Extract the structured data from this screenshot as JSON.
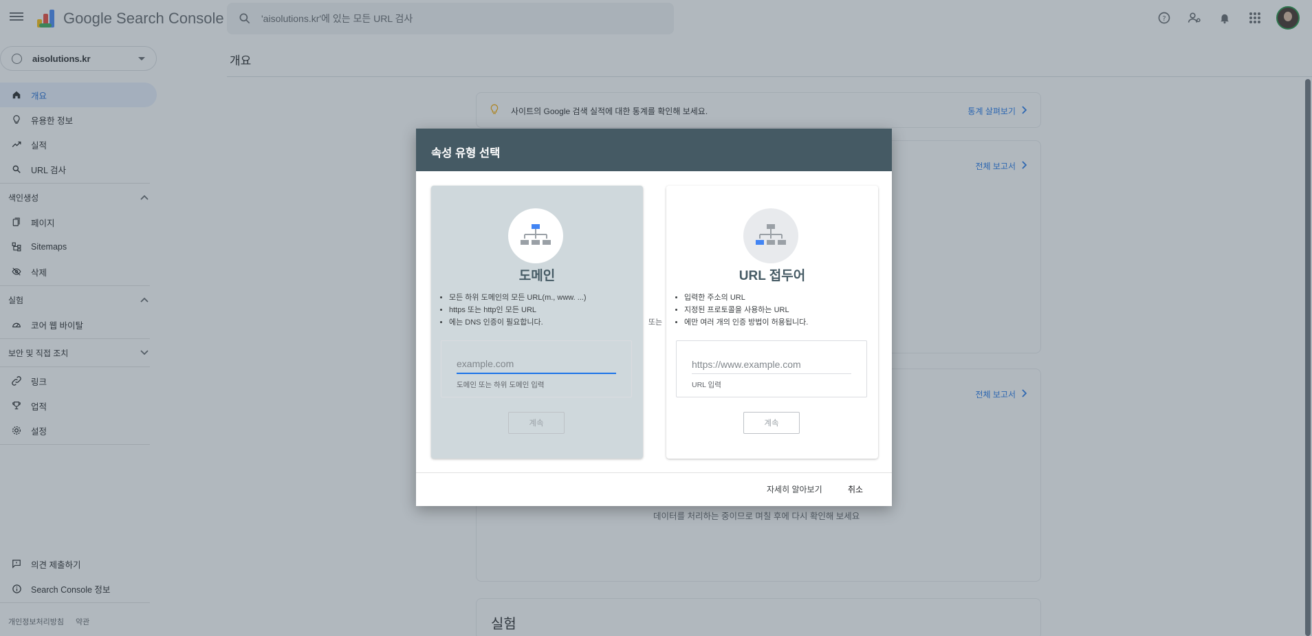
{
  "app": {
    "title": "Google Search Console",
    "search_placeholder": "'aisolutions.kr'에 있는 모든 URL 검사"
  },
  "sidebar": {
    "property": "aisolutions.kr",
    "items_top": [
      {
        "label": "개요",
        "icon": "home-icon",
        "active": true
      },
      {
        "label": "유용한 정보",
        "icon": "lightbulb-icon"
      },
      {
        "label": "실적",
        "icon": "trending-up-icon"
      },
      {
        "label": "URL 검사",
        "icon": "search-icon"
      }
    ],
    "section_indexing": "색인생성",
    "items_indexing": [
      {
        "label": "페이지",
        "icon": "pages-icon"
      },
      {
        "label": "Sitemaps",
        "icon": "sitemap-icon"
      },
      {
        "label": "삭제",
        "icon": "eye-off-icon"
      }
    ],
    "section_experience": "실험",
    "items_experience": [
      {
        "label": "코어 웹 바이탈",
        "icon": "speedometer-icon"
      }
    ],
    "section_security": "보안 및 직접 조치",
    "items_other": [
      {
        "label": "링크",
        "icon": "link-icon"
      },
      {
        "label": "업적",
        "icon": "trophy-icon"
      },
      {
        "label": "설정",
        "icon": "gear-icon"
      }
    ],
    "items_bottom": [
      {
        "label": "의견 제출하기",
        "icon": "feedback-icon"
      },
      {
        "label": "Search Console 정보",
        "icon": "info-icon"
      }
    ],
    "footer_privacy": "개인정보처리방침",
    "footer_terms": "약관"
  },
  "main": {
    "page_title": "개요",
    "tip_text": "사이트의 Google 검색 실적에 대한 통계를 확인해 보세요.",
    "tip_link": "통계 살펴보기",
    "report_link": "전체 보고서",
    "processing_text": "데이터를 처리하는 중이므로 며칠 후에 다시 확인해 보세요",
    "experience_title": "실험"
  },
  "dialog": {
    "title": "속성 유형 선택",
    "or_label": "또는",
    "domain": {
      "title": "도메인",
      "bullets": [
        "모든 하위 도메인의 모든 URL(m., www. ...)",
        "https 또는 http인 모든 URL",
        "에는 DNS 인증이 필요합니다."
      ],
      "placeholder": "example.com",
      "helper": "도메인 또는 하위 도메인 입력",
      "continue": "계속"
    },
    "url_prefix": {
      "title": "URL 접두어",
      "bullets": [
        "입력한 주소의 URL",
        "지정된 프로토콜을 사용하는 URL",
        "에만 여러 개의 인증 방법이 허용됩니다."
      ],
      "placeholder": "https://www.example.com",
      "helper": "URL 입력",
      "continue": "계속"
    },
    "learn_more": "자세히 알아보기",
    "cancel": "취소"
  },
  "colors": {
    "dialog_header": "#455a64",
    "accent": "#1a73e8",
    "domain_card_bg": "#cfd8dc"
  }
}
